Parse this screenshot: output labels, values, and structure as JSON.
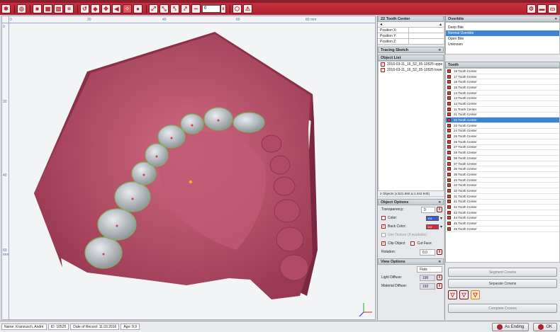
{
  "toolbar": {
    "number_value": "0"
  },
  "rulers": {
    "top_ticks": [
      "0",
      "20",
      "40",
      "60",
      "80 mm"
    ],
    "left_ticks": [
      "0",
      "20",
      "40",
      "60 mm"
    ]
  },
  "tooth_center": {
    "title": "22 Tooth Center",
    "fields": [
      {
        "label": "Position X:",
        "value": ""
      },
      {
        "label": "Position Y:",
        "value": ""
      },
      {
        "label": "Position Z:",
        "value": ""
      }
    ]
  },
  "tracing_sketch": {
    "title": "Tracing Sketch"
  },
  "object_list": {
    "title": "Object List",
    "items": [
      "2016-03-11_16_52_35-10525 uppe",
      "2016-03-11_16_52_35-10525 lowe"
    ],
    "footer": "2 Objects (x:521.590 Δ:1.042.940)"
  },
  "object_options": {
    "title": "Object Options",
    "transparency_label": "Transparency:",
    "transparency_value": "0",
    "color_label": "Color:",
    "color_value": "104",
    "color_hex": "#3a5bd8",
    "back_color_label": "Back Color:",
    "back_color_value": "244",
    "back_color_hex": "#d8263a",
    "use_texture_label": "Use Texture  (if available)",
    "clip_object_label": "Clip Object",
    "cut_face_label": "Cut Face",
    "rotation_label": "Rotation:",
    "rotation_value": "0,0"
  },
  "view_options": {
    "title": "View Options",
    "shading_value": "Flats",
    "light_diffuse_label": "Light Diffuse:",
    "light_diffuse_value": "190",
    "material_diffuse_label": "Material Diffuse:",
    "material_diffuse_value": "192"
  },
  "overbite": {
    "title": "Overbite",
    "items": [
      "Deep Bite",
      "Normal Overbite",
      "Open Bite",
      "Unknown"
    ],
    "selected_index": 1
  },
  "teeth": {
    "title": "Tooth",
    "items": [
      "18 Tooth Center",
      "17 Tooth Center",
      "16 Tooth Center",
      "15 Tooth Center",
      "14 Tooth Center",
      "13 Tooth Center",
      "12 Tooth Center",
      "11 Tooth Center",
      "21 Tooth Center",
      "22 Tooth Center",
      "23 Tooth Center",
      "24 Tooth Center",
      "25 Tooth Center",
      "26 Tooth Center",
      "27 Tooth Center",
      "28 Tooth Center",
      "38 Tooth Center",
      "37 Tooth Center",
      "36 Tooth Center",
      "35 Tooth Center",
      "34 Tooth Center",
      "33 Tooth Center",
      "32 Tooth Center",
      "31 Tooth Center",
      "41 Tooth Center",
      "42 Tooth Center",
      "43 Tooth Center",
      "44 Tooth Center",
      "45 Tooth Center",
      "46 Tooth Center"
    ],
    "selected_index": 9
  },
  "actions": {
    "segment_crowns": "Segment Crowns",
    "separate_crowns": "Separate Crowns",
    "complete_crowns": "Complete Crowns"
  },
  "status": {
    "name": "Name: Kranzusch, André",
    "id": "ID: 10525",
    "date": "Date of Record: 11.03.2016",
    "age": "Age: 9,9",
    "as_ending": "As Ending",
    "ok": "OK"
  },
  "colors": {
    "brand": "#b0202e",
    "gum": "#b8516a",
    "tooth": "#a8aeb4",
    "selection": "#3b84d6"
  }
}
